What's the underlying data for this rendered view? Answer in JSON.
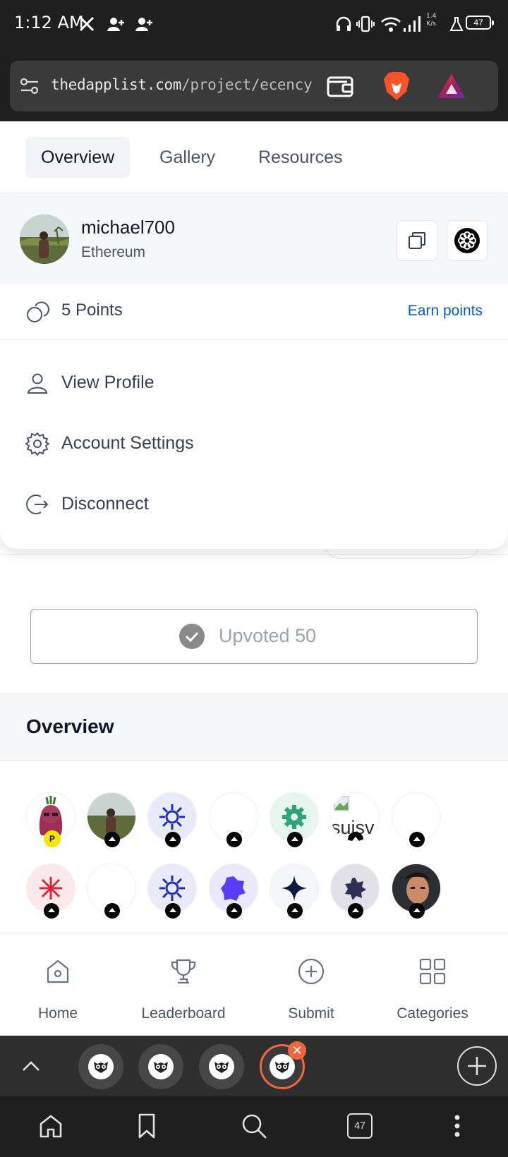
{
  "status_bar": {
    "time": "1:12 AM",
    "net_speed_value": "1.4",
    "net_speed_unit": "K/s",
    "battery": "47",
    "icons": [
      "x-logo-icon",
      "add-contact-icon",
      "add-contact-icon",
      "headphones-icon",
      "vibrate-icon",
      "wifi-icon",
      "signal-icon",
      "lab-flask-icon",
      "battery-icon"
    ]
  },
  "browser": {
    "url_domain": "thedapplist.com",
    "url_path": "/project/ecency",
    "icons": [
      "site-settings-icon",
      "wallet-icon",
      "brave-lion-icon",
      "brave-rewards-icon"
    ]
  },
  "tabs": [
    {
      "label": "Overview",
      "active": true
    },
    {
      "label": "Gallery",
      "active": false
    },
    {
      "label": "Resources",
      "active": false
    }
  ],
  "account": {
    "username": "michael700",
    "chain": "Ethereum",
    "points": "5 Points",
    "earn_label": "Earn points"
  },
  "menu": {
    "view_profile": "View Profile",
    "account_settings": "Account Settings",
    "disconnect": "Disconnect"
  },
  "upvote": {
    "label": "Upvoted 50"
  },
  "overview": {
    "heading": "Overview",
    "broken_avatar_text": "suisv",
    "p_badge": "P"
  },
  "bottom_nav": [
    {
      "label": "Home",
      "icon": "home-icon"
    },
    {
      "label": "Leaderboard",
      "icon": "trophy-icon"
    },
    {
      "label": "Submit",
      "icon": "plus-circle-icon"
    },
    {
      "label": "Categories",
      "icon": "grid-icon"
    }
  ],
  "browser_tabs": {
    "close_label": "✕",
    "tab_count": "47"
  },
  "colors": {
    "accent_link": "#0a5cc4",
    "tab_active_ring": "#f0673e",
    "brave_orange": "#fb542b"
  }
}
